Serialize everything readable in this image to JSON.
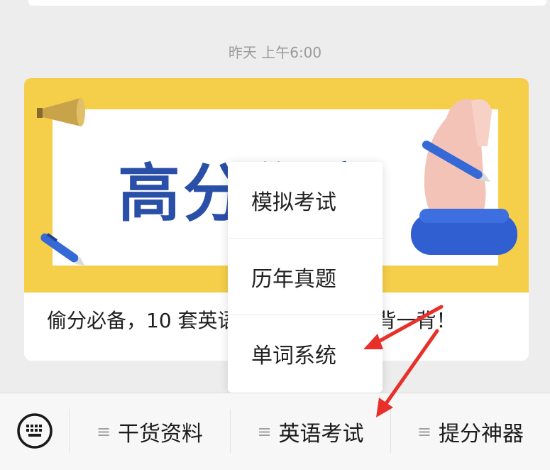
{
  "chat": {
    "timestamp": "昨天 上午6:00"
  },
  "article_card": {
    "banner_title": "高分伤害",
    "caption": "偷分必备，10 套英语高频词汇，平时背一背！"
  },
  "popup_menu": {
    "items": [
      "模拟考试",
      "历年真题",
      "单词系统"
    ]
  },
  "bottom_menu": {
    "tabs": [
      {
        "icon": "menu-lines-icon",
        "label": "干货资料"
      },
      {
        "icon": "menu-lines-icon",
        "label": "英语考试"
      },
      {
        "icon": "menu-lines-icon",
        "label": "提分神器"
      }
    ],
    "keyboard_icon": "keyboard-icon",
    "hamburger_glyph": "≡"
  },
  "colors": {
    "banner_yellow": "#f5cf4a",
    "banner_title_blue": "#2a4fa8",
    "annotation_red": "#e8302a"
  }
}
